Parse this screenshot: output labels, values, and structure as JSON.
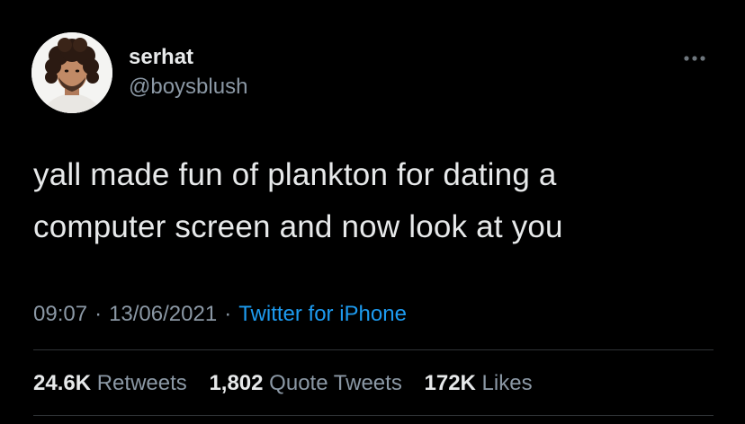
{
  "author": {
    "display_name": "serhat",
    "handle": "@boysblush",
    "avatar_icon": "profile-photo"
  },
  "tweet": {
    "line1": "yall made fun of plankton for dating a",
    "line2": "computer screen and now look at you"
  },
  "meta": {
    "time": "09:07",
    "separator": "·",
    "date": "13/06/2021",
    "source": "Twitter for iPhone"
  },
  "stats": {
    "retweets_count": "24.6K",
    "retweets_label": "Retweets",
    "quotes_count": "1,802",
    "quotes_label": "Quote Tweets",
    "likes_count": "172K",
    "likes_label": "Likes"
  },
  "colors": {
    "background": "#000000",
    "text_primary": "#e7e9ea",
    "text_secondary": "#8b98a5",
    "link": "#1d9bf0",
    "divider": "#2f3336"
  }
}
